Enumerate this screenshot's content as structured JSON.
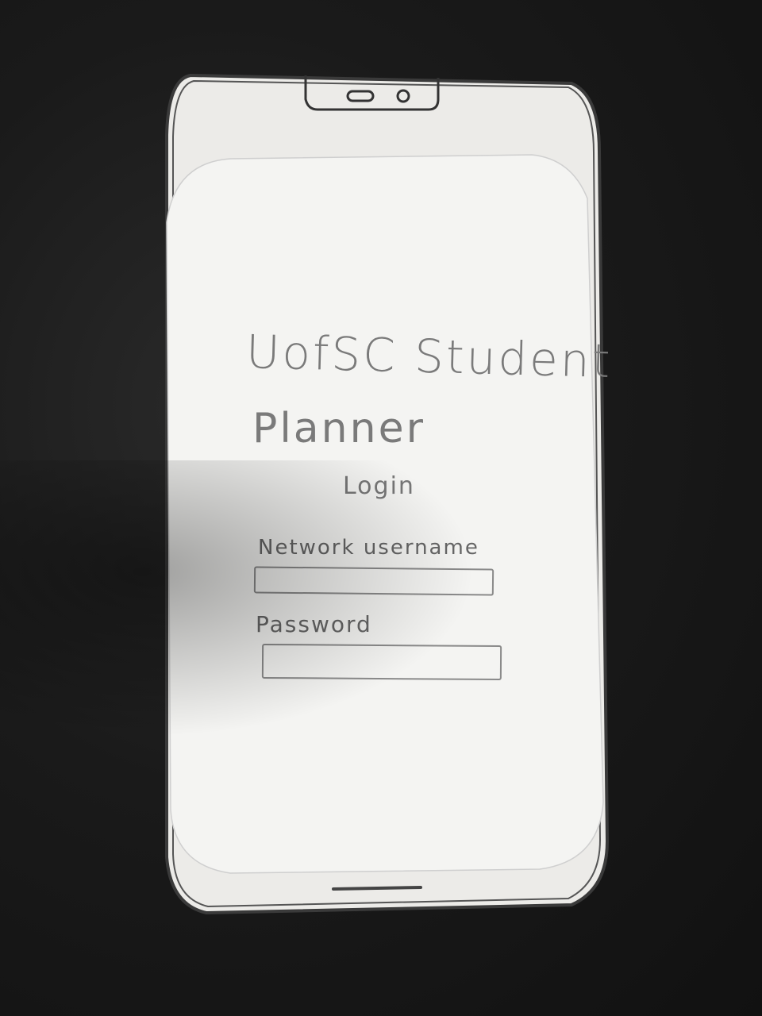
{
  "app": {
    "title_line1": "UofSC Student",
    "title_line2": "Planner"
  },
  "login": {
    "heading": "Login",
    "username_label": "Network username",
    "username_value": "",
    "password_label": "Password",
    "password_value": ""
  },
  "device": {
    "notch_icon": "camera-notch-icon",
    "home_indicator_icon": "home-indicator-icon"
  },
  "colors": {
    "paper": "#f3f3f1",
    "pencil": "#6f6f6f",
    "background": "#141414"
  }
}
